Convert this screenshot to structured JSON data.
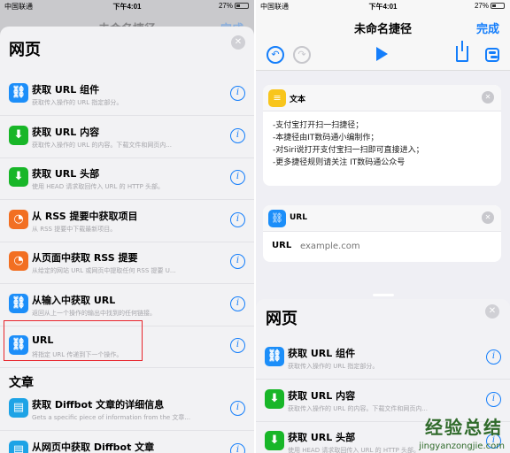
{
  "left": {
    "status": {
      "carrier": "中国联通",
      "time": "下午4:01",
      "battery": "27%"
    },
    "nav": {
      "title": "未命名捷径",
      "done": "完成"
    },
    "sheet": {
      "title": "网页",
      "items": [
        {
          "icon": "link",
          "title": "获取 URL 组件",
          "subtitle": "获取传入操作的 URL 指定部分。"
        },
        {
          "icon": "download",
          "title": "获取 URL 内容",
          "subtitle": "获取传入操作的 URL 的内容。下载文件和网页内..."
        },
        {
          "icon": "download",
          "title": "获取 URL 头部",
          "subtitle": "使用 HEAD 请求取回传入 URL 的 HTTP 头部。"
        },
        {
          "icon": "rss",
          "title": "从 RSS 提要中获取项目",
          "subtitle": "从 RSS 提要中下载最新项目。"
        },
        {
          "icon": "rss",
          "title": "从页面中获取 RSS 提要",
          "subtitle": "从给定的网站 URL 或网页中提取任何 RSS 提要 U..."
        },
        {
          "icon": "link",
          "title": "从输入中获取 URL",
          "subtitle": "返回从上一个操作的输出中找到的任何链接。"
        },
        {
          "icon": "link",
          "title": "URL",
          "subtitle": "将指定 URL 传递到下一个操作。"
        }
      ],
      "section2": "文章",
      "items2": [
        {
          "icon": "doc",
          "title": "获取 Diffbot 文章的详细信息",
          "subtitle": "Gets a specific piece of information from the 文章..."
        },
        {
          "icon": "doc",
          "title": "从网页中获取 Diffbot 文章",
          "subtitle": ""
        }
      ]
    }
  },
  "right": {
    "status": {
      "carrier": "中国联通",
      "time": "下午4:01",
      "battery": "27%"
    },
    "nav": {
      "title": "未命名捷径",
      "done": "完成"
    },
    "text_card": {
      "title": "文本",
      "lines": [
        "-支付宝打开扫一扫捷径；",
        "-本捷径由IT数码通小编制作；",
        "-对Siri说打开支付宝扫一扫即可直接进入；",
        "-更多捷径规则请关注 IT数码通公众号"
      ]
    },
    "url_card": {
      "title": "URL",
      "field_label": "URL",
      "placeholder": "example.com"
    },
    "sheet": {
      "title": "网页",
      "items": [
        {
          "icon": "link",
          "title": "获取 URL 组件",
          "subtitle": "获取传入操作的 URL 指定部分。"
        },
        {
          "icon": "download",
          "title": "获取 URL 内容",
          "subtitle": "获取传入操作的 URL 的内容。下载文件和网页内..."
        },
        {
          "icon": "download",
          "title": "获取 URL 头部",
          "subtitle": "使用 HEAD 请求取回传入 URL 的 HTTP 头部。"
        }
      ]
    },
    "watermark": {
      "main": "经验总结",
      "sub": "jingyanzongjie.com"
    }
  }
}
